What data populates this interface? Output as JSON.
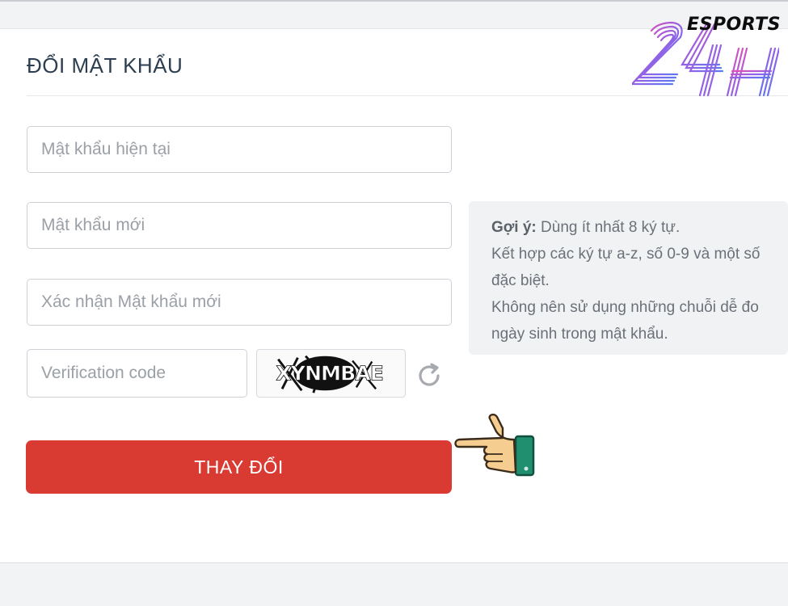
{
  "form": {
    "title": "ĐỔI MẬT KHẨU",
    "current_password_placeholder": "Mật khẩu hiện tại",
    "new_password_placeholder": "Mật khẩu mới",
    "confirm_password_placeholder": "Xác nhận Mật khẩu mới",
    "verification_placeholder": "Verification code",
    "captcha_text": "XYNMBAE",
    "submit_label": "THAY ĐỔI"
  },
  "hint": {
    "label": "Gợi ý:",
    "line1_rest": " Dùng ít nhất 8 ký tự.",
    "line2": "Kết hợp các ký tự a-z, số 0-9 và một số",
    "line3": "đặc biệt.",
    "line4": "Không nên sử dụng những chuỗi dễ đo",
    "line5": "ngày sinh trong mật khẩu."
  },
  "watermark": {
    "brand": "ESPORTS",
    "number": "24H"
  },
  "icons": {
    "refresh": "refresh-icon",
    "pointer": "pointing-hand-icon"
  },
  "colors": {
    "primary_button": "#d93a32",
    "hint_background": "#f1f2f4",
    "logo_gradient": [
      "#e64fb7",
      "#8e63e8",
      "#5a7af0"
    ]
  }
}
